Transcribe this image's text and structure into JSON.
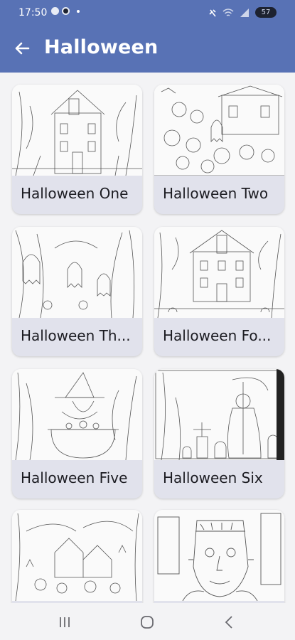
{
  "status_bar": {
    "time": "17:50",
    "battery": "57"
  },
  "app_bar": {
    "title": "Halloween",
    "back_icon": "arrow-left-icon"
  },
  "cards": [
    {
      "label": "Halloween One",
      "art": "haunted-mansion"
    },
    {
      "label": "Halloween Two",
      "art": "ghost-crowd"
    },
    {
      "label": "Halloween Th...",
      "art": "forest-ghosts"
    },
    {
      "label": "Halloween Fo...",
      "art": "haunted-mansion"
    },
    {
      "label": "Halloween Five",
      "art": "witch-cauldron"
    },
    {
      "label": "Halloween Six",
      "art": "grim-reaper"
    },
    {
      "label": "",
      "art": "haunted-mansion"
    },
    {
      "label": "",
      "art": "frankenstein"
    }
  ],
  "nav_bar": {
    "recents": "recents-icon",
    "home": "home-icon",
    "back": "back-icon"
  },
  "colors": {
    "accent": "#5872b5",
    "card_bg": "#e1e2ec",
    "page_bg": "#f3f3f5"
  }
}
